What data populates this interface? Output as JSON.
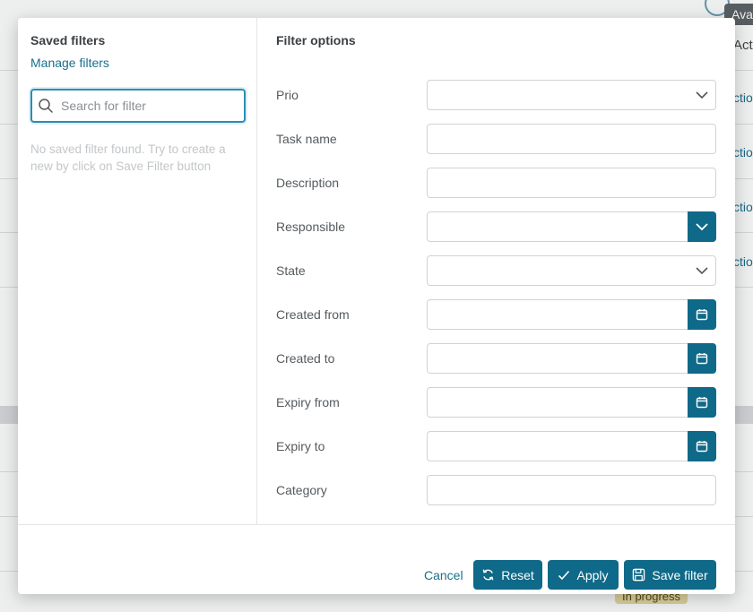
{
  "background": {
    "column_header": "Acti",
    "row_links": [
      "ctio",
      "ctio",
      "ctio",
      "ctio"
    ],
    "tooltip": "Ava",
    "status_badge": "In progress"
  },
  "saved_filters": {
    "title": "Saved filters",
    "manage_link": "Manage filters",
    "search_placeholder": "Search for filter",
    "empty_message": "No saved filter found. Try to create a new by click on Save Filter button"
  },
  "filter_options": {
    "title": "Filter options",
    "fields": [
      {
        "label": "Prio",
        "type": "select",
        "value": ""
      },
      {
        "label": "Task name",
        "type": "text",
        "value": ""
      },
      {
        "label": "Description",
        "type": "text",
        "value": ""
      },
      {
        "label": "Responsible",
        "type": "dropdown-button",
        "value": ""
      },
      {
        "label": "State",
        "type": "select",
        "value": ""
      },
      {
        "label": "Created from",
        "type": "date",
        "value": ""
      },
      {
        "label": "Created to",
        "type": "date",
        "value": ""
      },
      {
        "label": "Expiry from",
        "type": "date",
        "value": ""
      },
      {
        "label": "Expiry to",
        "type": "date",
        "value": ""
      },
      {
        "label": "Category",
        "type": "text",
        "value": ""
      }
    ]
  },
  "footer": {
    "cancel_label": "Cancel",
    "reset_label": "Reset",
    "apply_label": "Apply",
    "save_filter_label": "Save filter"
  },
  "colors": {
    "accent": "#0f6988",
    "link": "#1a6f8c",
    "focus_border": "#2a8db5"
  }
}
